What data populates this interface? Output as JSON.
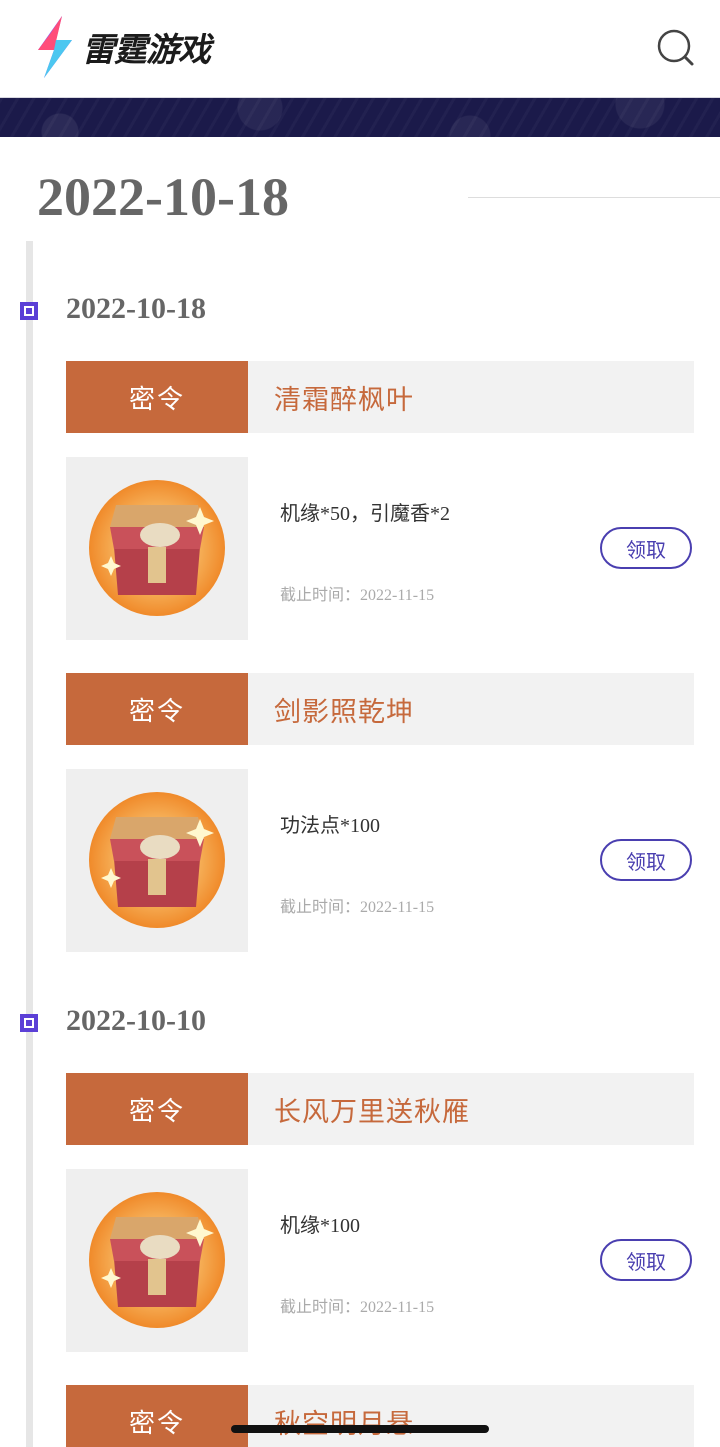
{
  "header": {
    "logo_text": "雷霆游戏",
    "icons": {
      "logo": "bolt-logo",
      "search": "search-icon"
    }
  },
  "page_title": "2022-10-18",
  "colors": {
    "accent": "#c6693c",
    "timeline": "#5b3fd6",
    "button": "#4a3fb0"
  },
  "groups": [
    {
      "date": "2022-10-18",
      "items": [
        {
          "tag": "密令",
          "code": "清霜醉枫叶",
          "reward": "机缘*50，引魔香*2",
          "deadline": "截止时间：2022-11-15",
          "button": "领取"
        },
        {
          "tag": "密令",
          "code": "剑影照乾坤",
          "reward": "功法点*100",
          "deadline": "截止时间：2022-11-15",
          "button": "领取"
        }
      ]
    },
    {
      "date": "2022-10-10",
      "items": [
        {
          "tag": "密令",
          "code": "长风万里送秋雁",
          "reward": "机缘*100",
          "deadline": "截止时间：2022-11-15",
          "button": "领取"
        },
        {
          "tag": "密令",
          "code": "秋空明月悬"
        }
      ]
    }
  ]
}
